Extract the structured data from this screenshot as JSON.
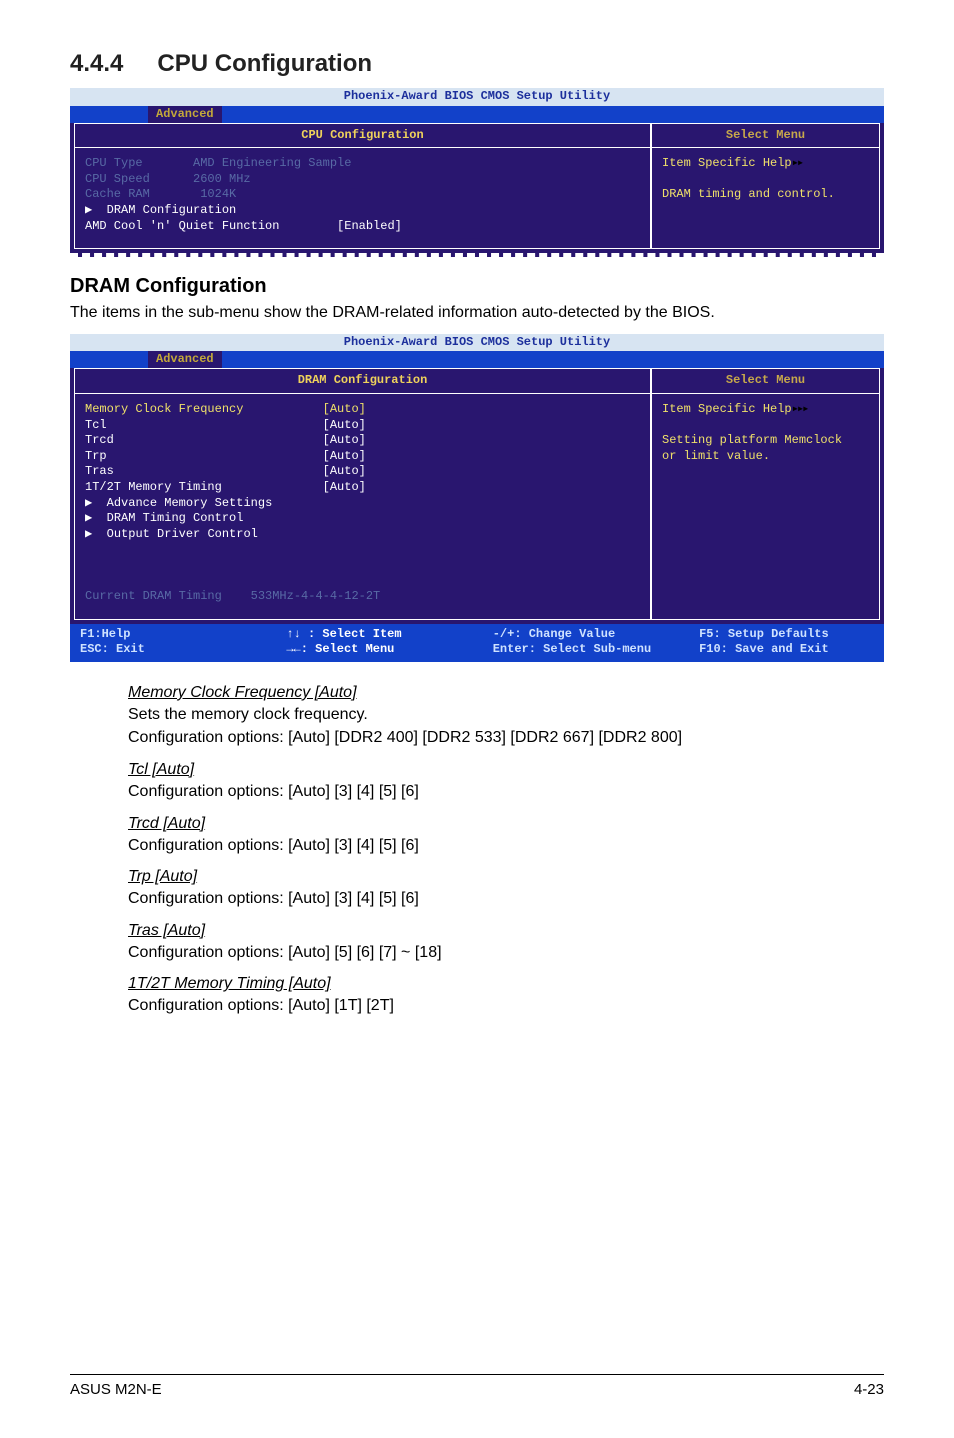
{
  "heading": {
    "number": "4.4.4",
    "title": "CPU Configuration"
  },
  "bios1": {
    "utilTitle": "Phoenix-Award BIOS CMOS Setup Utility",
    "tab": "Advanced",
    "leftTitle": "CPU Configuration",
    "rightTitle": "Select Menu",
    "helpHeader": "Item Specific Help",
    "helpBody": "DRAM timing and control.",
    "rows": {
      "cpuType": "CPU Type       AMD Engineering Sample",
      "blank": "",
      "cpuSpeed": "CPU Speed      2600 MHz",
      "cacheRam": "Cache RAM       1024K",
      "dramConf": "  DRAM Configuration",
      "amdCool": "AMD Cool 'n' Quiet Function        [Enabled]"
    }
  },
  "sub": {
    "title": "DRAM Configuration",
    "desc": "The items in the sub-menu show the DRAM-related information auto-detected by the BIOS."
  },
  "bios2": {
    "utilTitle": "Phoenix-Award BIOS CMOS Setup Utility",
    "tab": "Advanced",
    "leftTitle": "DRAM Configuration",
    "rightTitle": "Select Menu",
    "helpHeader": "Item Specific Help",
    "helpBody1": "Setting platform Memclock",
    "helpBody2": "or limit value.",
    "rows": {
      "r1": "Memory Clock Frequency           [Auto]",
      "r2": "Tcl                              [Auto]",
      "r3": "Trcd                             [Auto]",
      "r4": "Trp                              [Auto]",
      "r5": "Tras                             [Auto]",
      "r6": "1T/2T Memory Timing              [Auto]",
      "r7": "  Advance Memory Settings",
      "r8": "  DRAM Timing Control",
      "r9": "  Output Driver Control",
      "cur": "Current DRAM Timing    533MHz-4-4-4-12-2T"
    },
    "legend": {
      "c1a": "F1:Help",
      "c1b": "ESC: Exit",
      "c2a": "↑↓ : Select Item",
      "c2b": "→←: Select Menu",
      "c3a": "-/+: Change Value",
      "c3b": "Enter: Select Sub-menu",
      "c4a": "F5: Setup Defaults",
      "c4b": "F10: Save and Exit"
    }
  },
  "params": {
    "p1t": "Memory Clock Frequency [Auto]",
    "p1a": "Sets the memory clock frequency.",
    "p1b": "Configuration options: [Auto] [DDR2 400] [DDR2 533] [DDR2 667] [DDR2 800]",
    "p2t": "Tcl [Auto]",
    "p2a": "Configuration options: [Auto] [3] [4] [5] [6]",
    "p3t": "Trcd [Auto]",
    "p3a": "Configuration options: [Auto] [3] [4] [5] [6]",
    "p4t": "Trp [Auto]",
    "p4a": "Configuration options: [Auto] [3] [4] [5] [6]",
    "p5t": "Tras [Auto]",
    "p5a": "Configuration options: [Auto] [5] [6] [7] ~ [18]",
    "p6t": "1T/2T Memory Timing [Auto]",
    "p6a": "Configuration options: [Auto] [1T] [2T]"
  },
  "footer": {
    "left": "ASUS M2N-E",
    "right": "4-23"
  }
}
